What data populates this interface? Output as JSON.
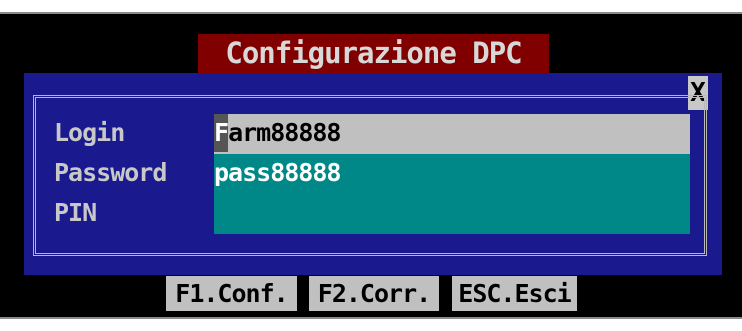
{
  "dialog": {
    "title": "Configurazione DPC",
    "close_label": "X"
  },
  "fields": {
    "login": {
      "label": "Login",
      "value_first": "F",
      "value_rest": "arm88888"
    },
    "password": {
      "label": "Password",
      "value": "pass88888"
    },
    "pin": {
      "label": "PIN",
      "value": ""
    }
  },
  "function_keys": [
    {
      "label": "F1.Conf."
    },
    {
      "label": "F2.Corr."
    },
    {
      "label": "ESC.Esci"
    }
  ],
  "colors": {
    "screen": "#000000",
    "title_bg": "#800000",
    "dialog_bg": "#1a1a8e",
    "input_active_bg": "#c0c0c0",
    "input_bg": "#008888"
  }
}
